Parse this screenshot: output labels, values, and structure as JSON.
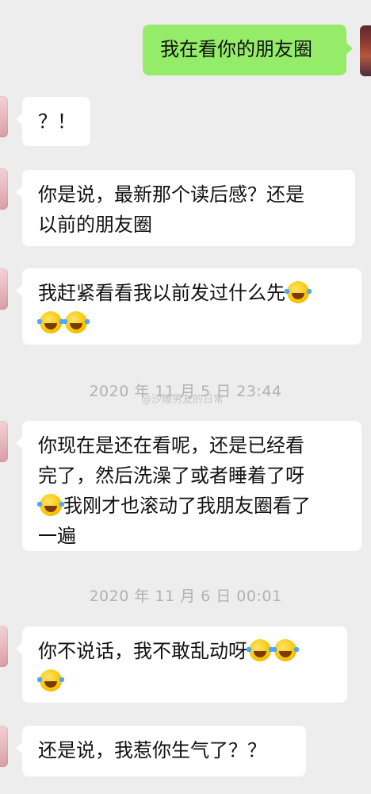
{
  "messages": {
    "m1": "我在看你的朋友圈",
    "m2": "？！",
    "m3_line1": "你是说，最新那个读后感？还是",
    "m3_line2": "以前的朋友圈",
    "m4_line1": "我赶紧看看我以前发过什么先",
    "m5_line1": "你现在是还在看呢，还是已经看",
    "m5_line2": "完了，然后洗澡了或者睡着了呀",
    "m5_line3": "我刚才也滚动了我朋友圈看了",
    "m5_line4": "一遍",
    "m6_line1": "你不说话，我不敢乱动呀",
    "m7": "还是说，我惹你生气了？？"
  },
  "timestamps": {
    "t1": "2020 年 11 月 5 日  23:44",
    "t2": "2020 年 11 月 6 日  00:01"
  },
  "watermark": "@沙雕男友的日常",
  "emoji_name": "face-with-tears-of-joy",
  "colors": {
    "background": "#ededed",
    "sent_bubble": "#95ec69",
    "received_bubble": "#ffffff",
    "timestamp_text": "#b2b2b2"
  }
}
